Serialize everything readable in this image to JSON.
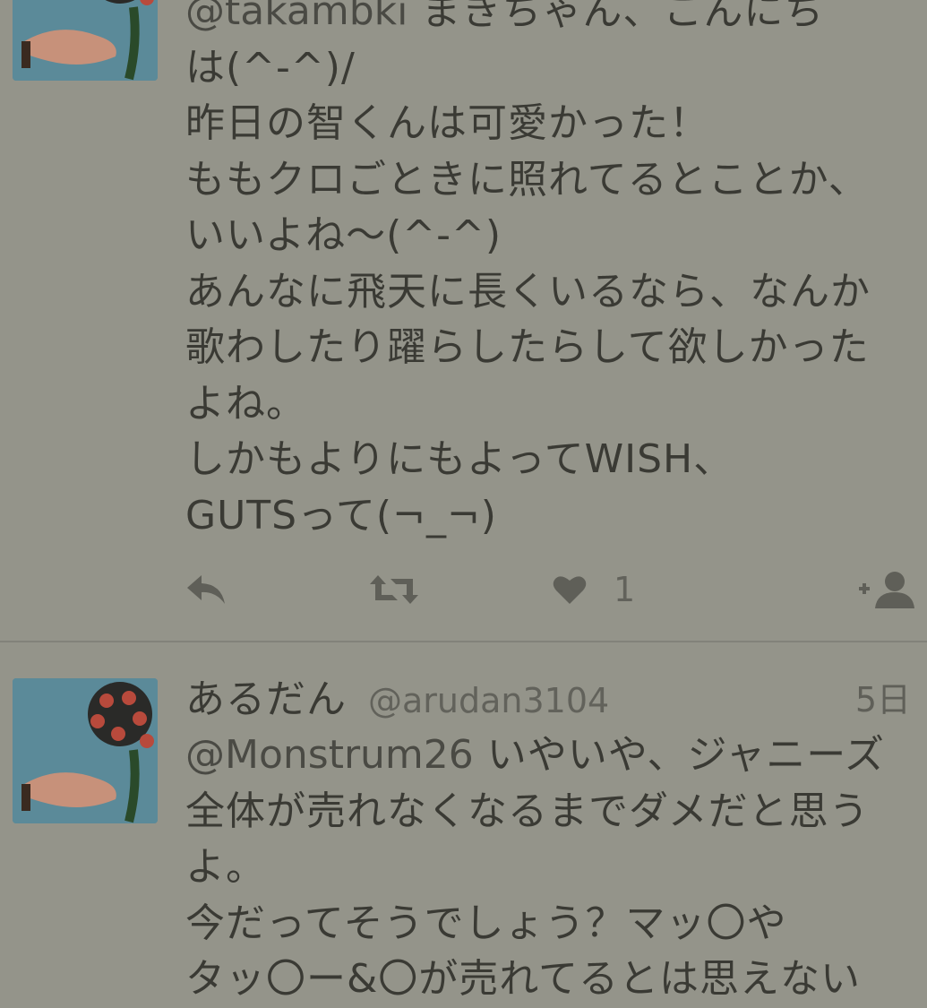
{
  "tweets": [
    {
      "lines": [
        {
          "mention": "@takambki",
          "text": " まきちゃん、こんにち"
        },
        {
          "mention": "",
          "text": "は(^-^)/"
        },
        {
          "mention": "",
          "text": "昨日の智くんは可愛かった！"
        },
        {
          "mention": "",
          "text": "ももクロごときに照れてるとことか、"
        },
        {
          "mention": "",
          "text": "いいよね〜(^-^)"
        },
        {
          "mention": "",
          "text": "あんなに飛天に長くいるなら、なんか"
        },
        {
          "mention": "",
          "text": "歌わしたり躍らしたらして欲しかった"
        },
        {
          "mention": "",
          "text": "よね。"
        },
        {
          "mention": "",
          "text": "しかもよりにもよってWISH、"
        },
        {
          "mention": "",
          "text": "GUTSって(¬_¬)"
        }
      ],
      "actions": {
        "reply_icon": "reply-icon",
        "retweet_icon": "retweet-icon",
        "like_icon": "heart-icon",
        "like_count": "1",
        "follow_icon": "follow-user-icon"
      }
    },
    {
      "user_name": "あるだん",
      "user_handle": "@arudan3104",
      "time": "5日",
      "lines": [
        {
          "mention": "@Monstrum26",
          "text": " いやいや、ジャニーズ"
        },
        {
          "mention": "",
          "text": "全体が売れなくなるまでダメだと思う"
        },
        {
          "mention": "",
          "text": "よ。"
        },
        {
          "mention": "",
          "text": "今だってそうでしょう？マッ〇や"
        },
        {
          "mention": "",
          "text": "タッ〇ー&〇が売れてるとは思えない"
        }
      ]
    }
  ],
  "colors": {
    "background": "#94948a",
    "text": "#3a3a34",
    "secondary_text": "#62625b",
    "divider": "#82827a",
    "icon": "#5f5f58"
  }
}
